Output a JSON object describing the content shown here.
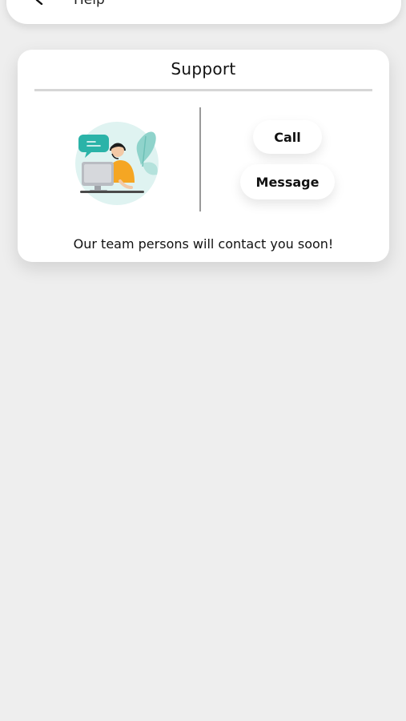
{
  "header": {
    "title": "Help",
    "back_icon": "back-arrow-icon"
  },
  "support_card": {
    "title": "Support",
    "illustration": "customer-support-agent-illustration",
    "call_label": "Call",
    "message_label": "Message",
    "footer_text": "Our team persons will contact you soon!"
  },
  "colors": {
    "background": "#eeeeee",
    "card": "#ffffff",
    "accent_teal": "#2bb3a8",
    "agent_shirt": "#f5a623"
  }
}
